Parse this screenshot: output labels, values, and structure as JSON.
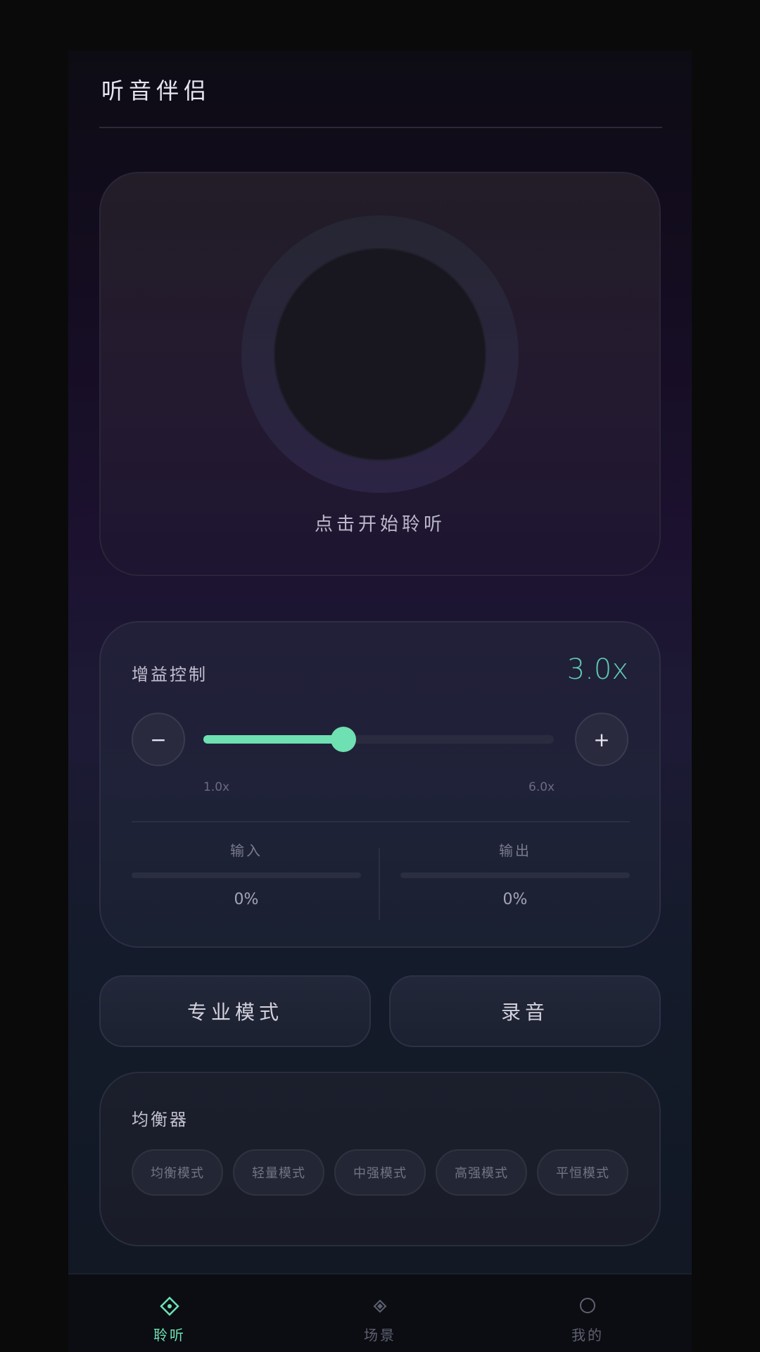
{
  "header": {
    "title": "听音伴侣"
  },
  "listen": {
    "hint": "点击开始聆听"
  },
  "gain": {
    "label": "增益控制",
    "value_text": "3.0x",
    "value": 3.0,
    "min": 1.0,
    "max": 6.0,
    "min_label": "1.0x",
    "max_label": "6.0x",
    "minus_symbol": "−",
    "plus_symbol": "+",
    "input": {
      "label": "输入",
      "level": 0,
      "value_text": "0%"
    },
    "output": {
      "label": "输出",
      "level": 0,
      "value_text": "0%"
    }
  },
  "actions": {
    "pro_mode": "专业模式",
    "record": "录音"
  },
  "equalizer": {
    "title": "均衡器",
    "modes": [
      "均衡模式",
      "轻量模式",
      "中强模式",
      "高强模式",
      "平恒模式"
    ]
  },
  "nav": {
    "items": [
      {
        "label": "聆听",
        "icon": "diamond-dot-icon",
        "active": true
      },
      {
        "label": "场景",
        "icon": "small-diamond-icon",
        "active": false
      },
      {
        "label": "我的",
        "icon": "circle-icon",
        "active": false
      }
    ]
  },
  "colors": {
    "accent": "#6ee0b2",
    "gain_value": "#5fc9b0",
    "background": "#0a0a0a"
  }
}
